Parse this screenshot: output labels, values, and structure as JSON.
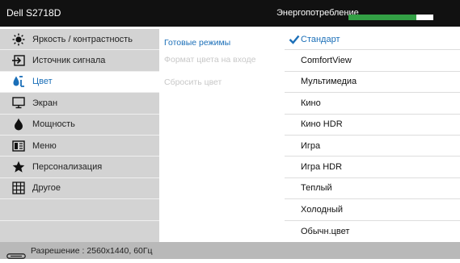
{
  "header": {
    "model": "Dell S2718D",
    "energy_label": "Энергопотребление",
    "energy_level": 0.8,
    "energy_color": "#33a045"
  },
  "sidebar": {
    "items": [
      {
        "label": "Яркость / контрастность",
        "icon": "brightness-icon"
      },
      {
        "label": "Источник сигнала",
        "icon": "input-source-icon"
      },
      {
        "label": "Цвет",
        "icon": "color-icon",
        "active": true
      },
      {
        "label": "Экран",
        "icon": "display-icon"
      },
      {
        "label": "Мощность",
        "icon": "power-icon"
      },
      {
        "label": "Меню",
        "icon": "menu-icon"
      },
      {
        "label": "Персонализация",
        "icon": "star-icon"
      },
      {
        "label": "Другое",
        "icon": "other-icon"
      }
    ]
  },
  "submenu": {
    "items": [
      {
        "label": "Готовые режимы",
        "state": "active"
      },
      {
        "label": "Формат цвета на входе",
        "state": "disabled"
      },
      {
        "label": "Сбросить цвет",
        "state": "disabled"
      }
    ]
  },
  "presets": {
    "items": [
      {
        "label": "Стандарт",
        "selected": true
      },
      {
        "label": "ComfortView"
      },
      {
        "label": "Мультимедиа"
      },
      {
        "label": "Кино"
      },
      {
        "label": "Кино HDR"
      },
      {
        "label": "Игра"
      },
      {
        "label": "Игра HDR"
      },
      {
        "label": "Теплый"
      },
      {
        "label": "Холодный"
      },
      {
        "label": "Обычн.цвет"
      }
    ]
  },
  "footer": {
    "resolution": "Разрешение : 2560x1440, 60Гц",
    "icon": "cable-icon"
  },
  "colors": {
    "accent": "#1b6fb8",
    "header_bg": "#111111",
    "sidebar_bg": "#d3d3d3",
    "footer_bg": "#b9b9b9"
  }
}
